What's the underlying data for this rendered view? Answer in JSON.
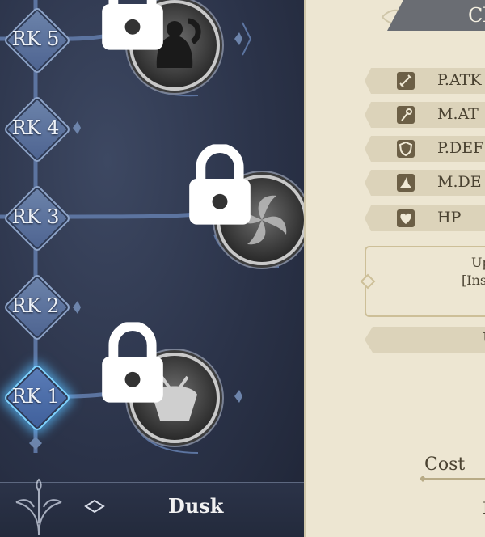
{
  "ranks": [
    {
      "label": "RK 5"
    },
    {
      "label": "RK 4"
    },
    {
      "label": "RK 3"
    },
    {
      "label": "RK 2"
    },
    {
      "label": "RK 1"
    }
  ],
  "bottom": {
    "name": "Dusk"
  },
  "panel": {
    "title": "Cl",
    "stats": [
      {
        "icon": "sword-icon",
        "label": "P.ATK"
      },
      {
        "icon": "staff-icon",
        "label": "M.AT"
      },
      {
        "icon": "shield-icon",
        "label": "P.DEF"
      },
      {
        "icon": "hat-icon",
        "label": "M.DE"
      },
      {
        "icon": "heart-icon",
        "label": "HP"
      }
    ],
    "upgrade_line1": "Up",
    "upgrade_line2": "[Ins",
    "upgrade_button": "U",
    "cost_label": "Cost",
    "cost_value_partial": "I"
  },
  "colors": {
    "accent_glow": "#7fd3ff",
    "panel_bg": "#ede6d2"
  }
}
